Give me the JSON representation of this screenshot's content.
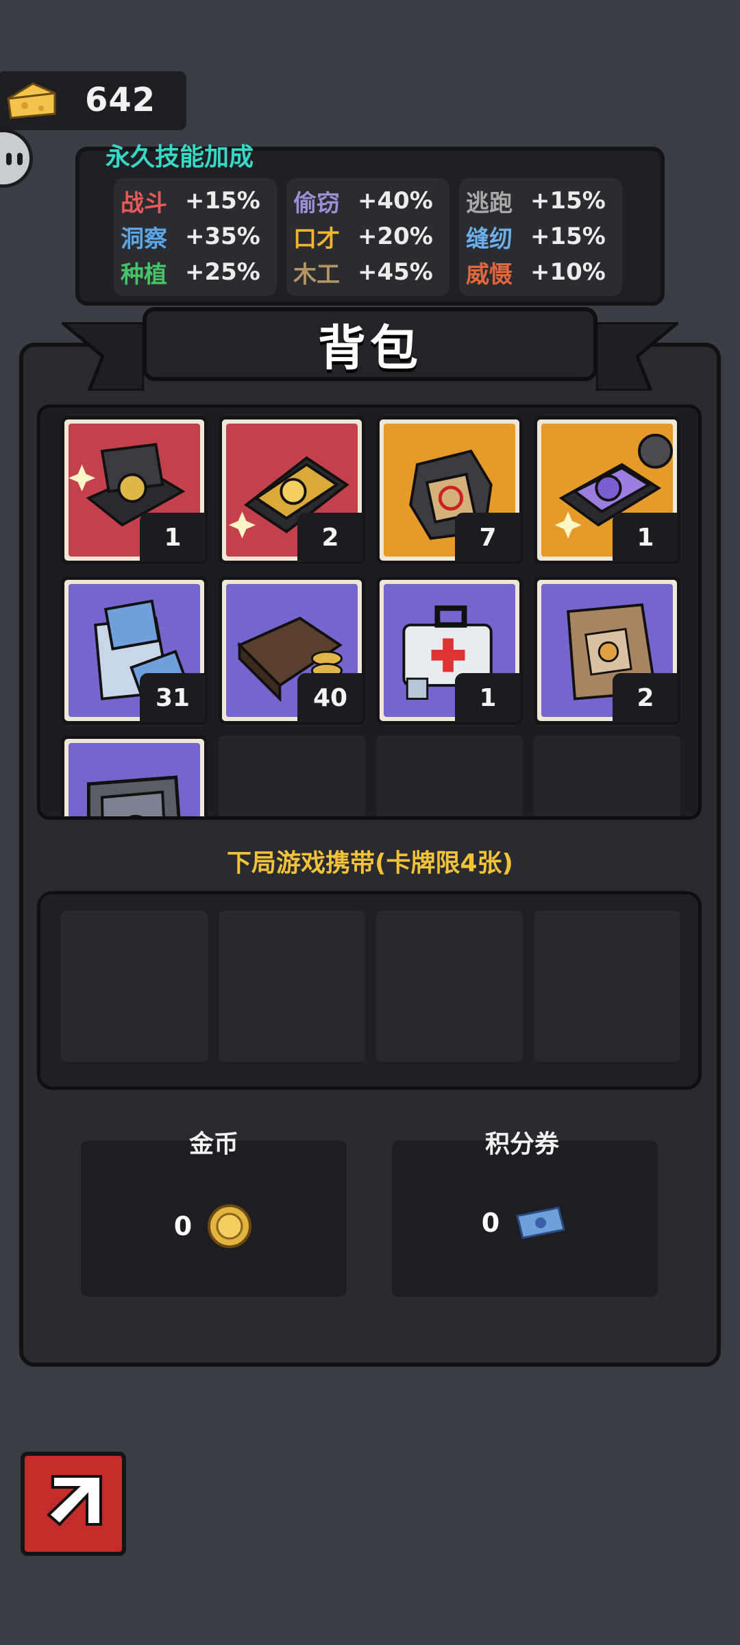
{
  "resources": {
    "cheese_count": "642"
  },
  "skills": {
    "title": "永久技能加成",
    "columns": [
      [
        {
          "name": "战斗",
          "value": "+15%",
          "color": "#e85a5a"
        },
        {
          "name": "洞察",
          "value": "+35%",
          "color": "#5aa7e8"
        },
        {
          "name": "种植",
          "value": "+25%",
          "color": "#47c46a"
        }
      ],
      [
        {
          "name": "偷窃",
          "value": "+40%",
          "color": "#9b8fd8"
        },
        {
          "name": "口才",
          "value": "+20%",
          "color": "#f0b532"
        },
        {
          "name": "木工",
          "value": "+45%",
          "color": "#b59466"
        }
      ],
      [
        {
          "name": "逃跑",
          "value": "+15%",
          "color": "#a9a9a9"
        },
        {
          "name": "缝纫",
          "value": "+15%",
          "color": "#6bb0ea"
        },
        {
          "name": "威慑",
          "value": "+10%",
          "color": "#e2683c"
        }
      ]
    ]
  },
  "backpack": {
    "title": "背包",
    "items": [
      {
        "icon": "red-gift-box-icon",
        "bg": "#c4404c",
        "count": "1"
      },
      {
        "icon": "gold-ticket-box-icon",
        "bg": "#c4404c",
        "count": "2"
      },
      {
        "icon": "dark-crate-icon",
        "bg": "#e69a2a",
        "count": "7"
      },
      {
        "icon": "purple-puzzle-box-icon",
        "bg": "#e69a2a",
        "count": "1"
      },
      {
        "icon": "ticket-bag-icon",
        "bg": "#7466cc",
        "count": "31"
      },
      {
        "icon": "wallet-coins-icon",
        "bg": "#7466cc",
        "count": "40"
      },
      {
        "icon": "first-aid-kit-icon",
        "bg": "#7466cc",
        "count": "1"
      },
      {
        "icon": "cheese-sack-icon",
        "bg": "#7466cc",
        "count": "2"
      },
      {
        "icon": "metal-case-icon",
        "bg": "#7466cc",
        "count": ""
      }
    ]
  },
  "carry": {
    "label": "下局游戏携带(卡牌限4张)"
  },
  "currency": {
    "gold": {
      "label": "金币",
      "value": "0"
    },
    "points": {
      "label": "积分券",
      "value": "0"
    }
  }
}
